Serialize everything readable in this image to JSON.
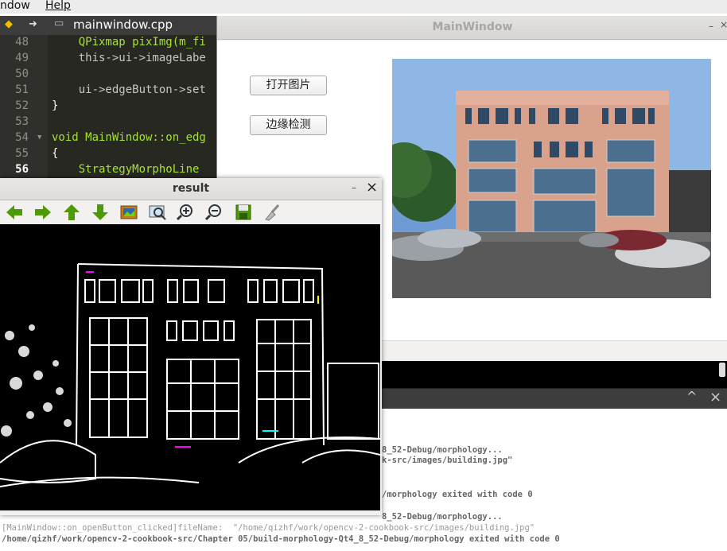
{
  "menubar": {
    "window_label": "ndow",
    "help_label": "Help"
  },
  "editor": {
    "tab_title": "mainwindow.cpp",
    "lines": [
      {
        "num": "48",
        "code": "    QPixmap pixImg(m_fi"
      },
      {
        "num": "49",
        "code": "    this->ui->imageLabe"
      },
      {
        "num": "50",
        "code": ""
      },
      {
        "num": "51",
        "code": "    ui->edgeButton->set"
      },
      {
        "num": "52",
        "code": "}"
      },
      {
        "num": "53",
        "code": ""
      },
      {
        "num": "54",
        "code": "void MainWindow::on_edg"
      },
      {
        "num": "55",
        "code": "{"
      },
      {
        "num": "56",
        "code": "    StrategyMorphoLine"
      }
    ]
  },
  "mainwindow": {
    "title": "MainWindow",
    "open_button": "打开图片",
    "edge_button": "边缘检测",
    "close_glyph": "×",
    "min_glyph": "–"
  },
  "result_window": {
    "title": "result",
    "min_glyph": "–",
    "close_glyph": "×",
    "toolbar_icons": [
      "arrow-left-icon",
      "arrow-right-icon",
      "arrow-up-icon",
      "arrow-down-icon",
      "image-icon",
      "zoom-fit-icon",
      "zoom-in-icon",
      "zoom-out-icon",
      "save-icon",
      "clear-icon"
    ]
  },
  "output_pane": {
    "collapse_glyph": "^",
    "close_glyph": "×",
    "lines": [
      "8_52-Debug/morphology...",
      "k-src/images/building.jpg\"",
      "/morphology exited with code 0",
      "8_52-Debug/morphology...",
      "[MainWindow::on_openButton_clicked]fileName:  \"/home/qizhf/work/opencv-2-cookbook-src/images/building.jpg\"",
      "/home/qizhf/work/opencv-2-cookbook-src/Chapter 05/build-morphology-Qt4_8_52-Debug/morphology exited with code 0"
    ]
  }
}
